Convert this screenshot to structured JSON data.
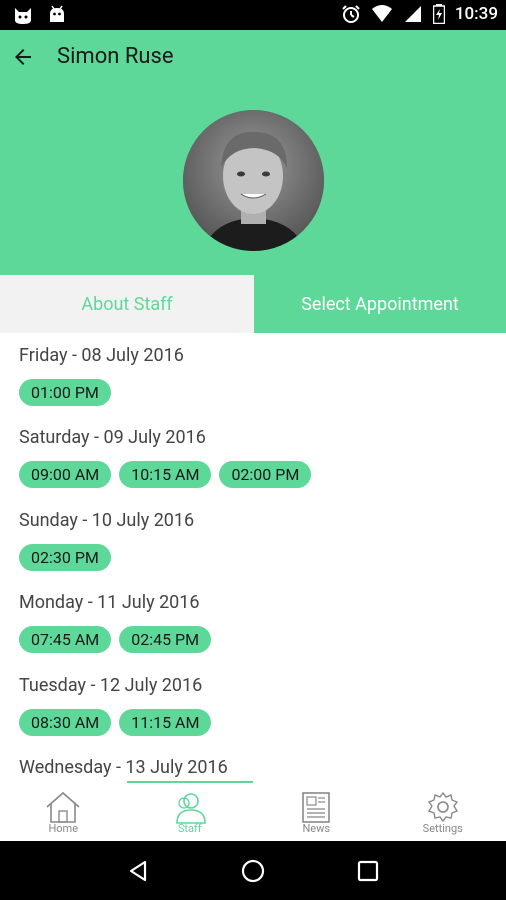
{
  "status_bar": {
    "time": "10:39"
  },
  "header": {
    "title": "Simon Ruse",
    "bg_color": "#5dd899"
  },
  "tabs": [
    {
      "label": "About Staff",
      "active": false
    },
    {
      "label": "Select Appointment",
      "active": true
    }
  ],
  "schedule": [
    {
      "day": "Friday - 08 July 2016",
      "slots": [
        "01:00 PM"
      ]
    },
    {
      "day": "Saturday - 09 July 2016",
      "slots": [
        "09:00 AM",
        "10:15 AM",
        "02:00 PM"
      ]
    },
    {
      "day": "Sunday - 10 July 2016",
      "slots": [
        "02:30 PM"
      ]
    },
    {
      "day": "Monday - 11 July 2016",
      "slots": [
        "07:45 AM",
        "02:45 PM"
      ]
    },
    {
      "day": "Tuesday - 12 July 2016",
      "slots": [
        "08:30 AM",
        "11:15 AM"
      ]
    },
    {
      "day": "Wednesday - 13 July 2016",
      "slots": []
    }
  ],
  "bottom_nav": [
    {
      "label": "Home",
      "icon": "home-icon",
      "active": false
    },
    {
      "label": "Staff",
      "icon": "staff-icon",
      "active": true
    },
    {
      "label": "News",
      "icon": "news-icon",
      "active": false
    },
    {
      "label": "Settings",
      "icon": "settings-icon",
      "active": false
    }
  ],
  "accent_color": "#5dd899"
}
